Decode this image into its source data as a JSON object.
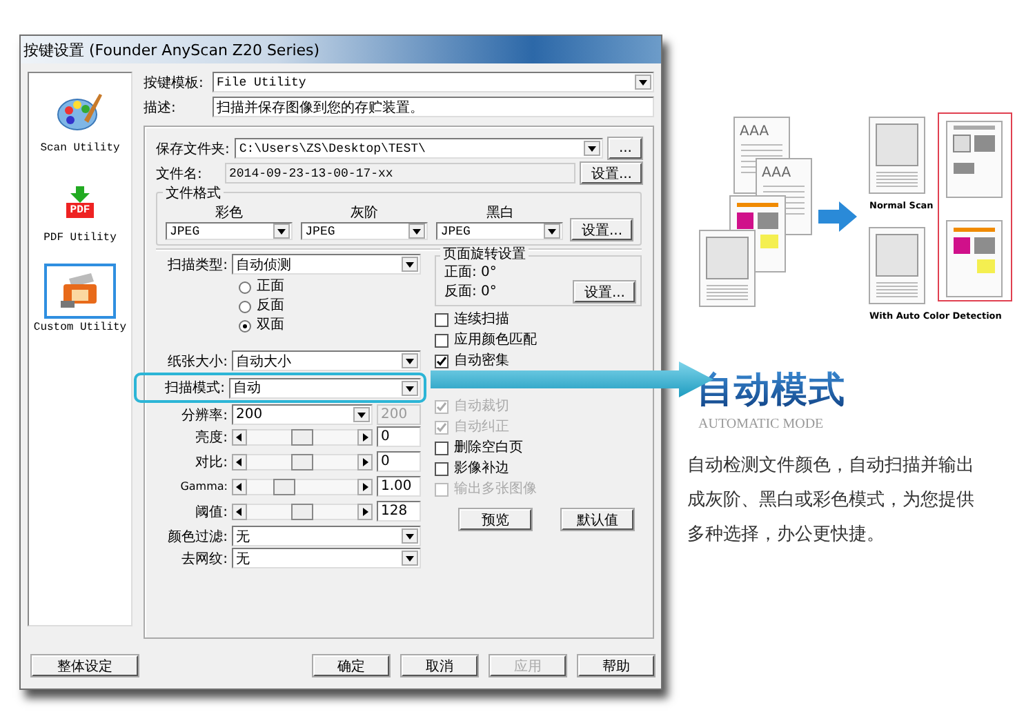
{
  "window": {
    "title": "按键设置 (Founder AnyScan Z20 Series)"
  },
  "sidebar": {
    "items": [
      {
        "kind": "palette",
        "label": "Scan Utility",
        "selected": false
      },
      {
        "kind": "pdf",
        "label": "PDF Utility",
        "badge": "PDF",
        "selected": false
      },
      {
        "kind": "scanner",
        "label": "Custom Utility",
        "selected": true
      }
    ]
  },
  "template": {
    "label": "按键模板:",
    "value": "File Utility"
  },
  "description": {
    "label": "描述:",
    "value": "扫描并保存图像到您的存贮装置。"
  },
  "save_folder": {
    "label": "保存文件夹:",
    "value": "C:\\Users\\ZS\\Desktop\\TEST\\",
    "browse": "..."
  },
  "file_name": {
    "label": "文件名:",
    "value": "2014-09-23-13-00-17-xx",
    "button": "设置..."
  },
  "file_format": {
    "title": "文件格式",
    "button": "设置...",
    "columns": [
      {
        "label": "彩色",
        "value": "JPEG"
      },
      {
        "label": "灰阶",
        "value": "JPEG"
      },
      {
        "label": "黑白",
        "value": "JPEG"
      }
    ]
  },
  "scan_type": {
    "label": "扫描类型:",
    "value": "自动侦测",
    "options": [
      {
        "label": "正面",
        "selected": false
      },
      {
        "label": "反面",
        "selected": false
      },
      {
        "label": "双面",
        "selected": true
      }
    ]
  },
  "paper_size": {
    "label": "纸张大小:",
    "value": "自动大小"
  },
  "scan_mode": {
    "label": "扫描模式:",
    "value": "自动",
    "highlighted": true
  },
  "resolution": {
    "label": "分辨率:",
    "value": "200",
    "reading": "200"
  },
  "sliders": [
    {
      "label": "亮度:",
      "level": 0.5,
      "reading": "0"
    },
    {
      "label": "对比:",
      "level": 0.5,
      "reading": "0"
    },
    {
      "label": "Gamma:",
      "level": 0.3,
      "reading": "1.00"
    },
    {
      "label": "阈值:",
      "level": 0.5,
      "reading": "128"
    }
  ],
  "color_filter": {
    "label": "颜色过滤:",
    "value": "无"
  },
  "descreen": {
    "label": "去网纹:",
    "value": "无"
  },
  "rotation": {
    "title": "页面旋转设置",
    "front": "正面: 0°",
    "back": "反面: 0°",
    "button": "设置..."
  },
  "options": [
    {
      "label": "连续扫描",
      "checked": false,
      "disabled": false
    },
    {
      "label": "应用颜色匹配",
      "checked": false,
      "disabled": false
    },
    {
      "label": "自动密集",
      "checked": true,
      "disabled": false
    },
    {
      "label": "自动裁切",
      "checked": true,
      "disabled": true
    },
    {
      "label": "自动纠正",
      "checked": true,
      "disabled": true
    },
    {
      "label": "删除空白页",
      "checked": false,
      "disabled": false
    },
    {
      "label": "影像补边",
      "checked": false,
      "disabled": false
    },
    {
      "label": "输出多张图像",
      "checked": false,
      "disabled": true
    }
  ],
  "panel_buttons": [
    {
      "label": "预览"
    },
    {
      "label": "默认值"
    }
  ],
  "footer": {
    "left": "整体设定",
    "buttons": [
      {
        "label": "确定",
        "disabled": false
      },
      {
        "label": "取消",
        "disabled": false
      },
      {
        "label": "应用",
        "disabled": true
      },
      {
        "label": "帮助",
        "disabled": false
      }
    ]
  },
  "feature": {
    "page_headings": [
      "AAA",
      "AAA"
    ],
    "captions": [
      "Normal Scan",
      "With Auto Color Detection"
    ],
    "title": "自动模式",
    "subtitle": "AUTOMATIC MODE",
    "text": "自动检测文件颜色，自动扫描并输出成灰阶、黑白或彩色模式，为您提供多种选择，办公更快捷。"
  }
}
